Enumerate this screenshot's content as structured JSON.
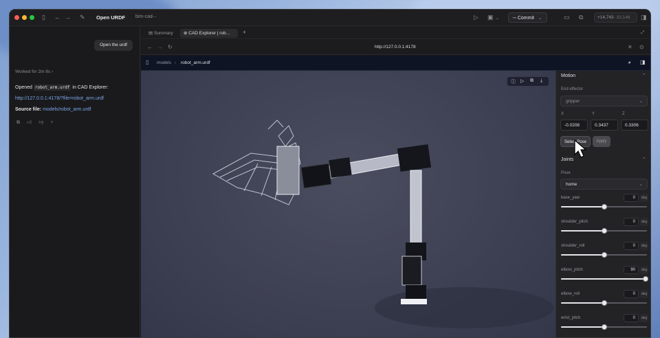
{
  "window": {
    "title": "Open URDF",
    "subtitle": "bim-cad",
    "commit_label": "Commit",
    "stats_plus": "+14,743",
    "stats_minus": "-33,146"
  },
  "left": {
    "open_urdf_button": "Open the urdf",
    "worked_for": "Worked for 2m 8s",
    "opened_prefix": "Opened",
    "opened_code": "robot_arm.urdf",
    "opened_suffix": "in CAD Explorer:",
    "link": "http://127.0.0.1:4178/?file=robot_arm.urdf",
    "source_label": "Source file:",
    "source_value": "models/robot_arm.urdf"
  },
  "tabs": [
    {
      "label": "Summary"
    },
    {
      "label": "CAD Explorer | rob…"
    }
  ],
  "browser": {
    "url": "http://127.0.0.1:4178"
  },
  "breadcrumb": {
    "folder": "models",
    "file": "robot_arm.urdf"
  },
  "motion": {
    "title": "Motion",
    "end_effector_label": "End effector",
    "end_effector_value": "gripper",
    "axis_x": "X",
    "axis_y": "Y",
    "axis_z": "Z",
    "x": "-0.0208",
    "y": "0.3437",
    "z": "0.3306",
    "select_pose_label": "Select Pose",
    "apply_label": "Apply",
    "joints_title": "Joints",
    "pose_label": "Pose",
    "pose_value": "home",
    "joints": [
      {
        "name": "base_yaw",
        "value": "0",
        "unit": "deg",
        "fraction": 0.5
      },
      {
        "name": "shoulder_pitch",
        "value": "0",
        "unit": "deg",
        "fraction": 0.5
      },
      {
        "name": "shoulder_roll",
        "value": "0",
        "unit": "deg",
        "fraction": 0.5
      },
      {
        "name": "elbow_pitch",
        "value": "90",
        "unit": "deg",
        "fraction": 0.98
      },
      {
        "name": "elbow_roll",
        "value": "0",
        "unit": "deg",
        "fraction": 0.5
      },
      {
        "name": "wrist_pitch",
        "value": "0",
        "unit": "deg",
        "fraction": 0.5
      }
    ]
  }
}
